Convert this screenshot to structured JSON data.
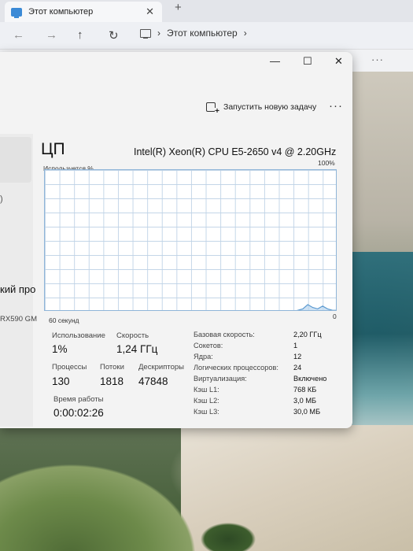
{
  "explorer": {
    "tab_title": "Этот компьютер",
    "tab_close": "✕",
    "tab_new": "+",
    "nav": {
      "back": "←",
      "forward": "→",
      "up": "↑",
      "refresh": "↻"
    },
    "breadcrumb_sep": "›",
    "breadcrumb_location": "Этот компьютер",
    "breadcrumb_more": "›",
    "more": "···"
  },
  "taskmanager": {
    "window_buttons": {
      "minimize": "—",
      "maximize": "☐",
      "close": "✕"
    },
    "run_new_task": "Запустить новую задачу",
    "more": "···",
    "sidebar": {
      "text_1": ")",
      "text_2": "кий про",
      "text_3": "RX590 GM"
    },
    "cpu": {
      "heading": "ЦП",
      "model": "Intel(R) Xeon(R) CPU E5-2650 v4 @ 2.20GHz",
      "util_label": "Используется %",
      "util_max": "100%",
      "x_left": "60 секунд",
      "x_right": "0",
      "stats": {
        "usage_label": "Использование",
        "usage_value": "1%",
        "speed_label": "Скорость",
        "speed_value": "1,24 ГГц",
        "processes_label": "Процессы",
        "processes_value": "130",
        "threads_label": "Потоки",
        "threads_value": "1818",
        "handles_label": "Дескрипторы",
        "handles_value": "47848",
        "uptime_label": "Время работы",
        "uptime_value": "0:00:02:26"
      },
      "specs": [
        {
          "label": "Базовая скорость:",
          "value": "2,20 ГГц"
        },
        {
          "label": "Сокетов:",
          "value": "1"
        },
        {
          "label": "Ядра:",
          "value": "12"
        },
        {
          "label": "Логических процессоров:",
          "value": "24"
        },
        {
          "label": "Виртуализация:",
          "value": "Включено"
        },
        {
          "label": "Кэш L1:",
          "value": "768 КБ"
        },
        {
          "label": "Кэш L2:",
          "value": "3,0 МБ"
        },
        {
          "label": "Кэш L3:",
          "value": "30,0 МБ"
        }
      ]
    },
    "graph_samples_percent": [
      0,
      0,
      0,
      0,
      0,
      0,
      0,
      0,
      0,
      0,
      0,
      0,
      0,
      0,
      0,
      0,
      0,
      0,
      0,
      0,
      0,
      0,
      0,
      0,
      0,
      0,
      0,
      0,
      0,
      0,
      0,
      0,
      0,
      0,
      0,
      0,
      0,
      0,
      0,
      0,
      0,
      0,
      0,
      0,
      0,
      0,
      0,
      0,
      0,
      0,
      0,
      1,
      2,
      5,
      3,
      2,
      4,
      2,
      1,
      1
    ],
    "colors": {
      "graph_line": "#5d9bd1",
      "graph_fill": "#b9d6ef",
      "graph_border": "#8fb5d8"
    }
  }
}
